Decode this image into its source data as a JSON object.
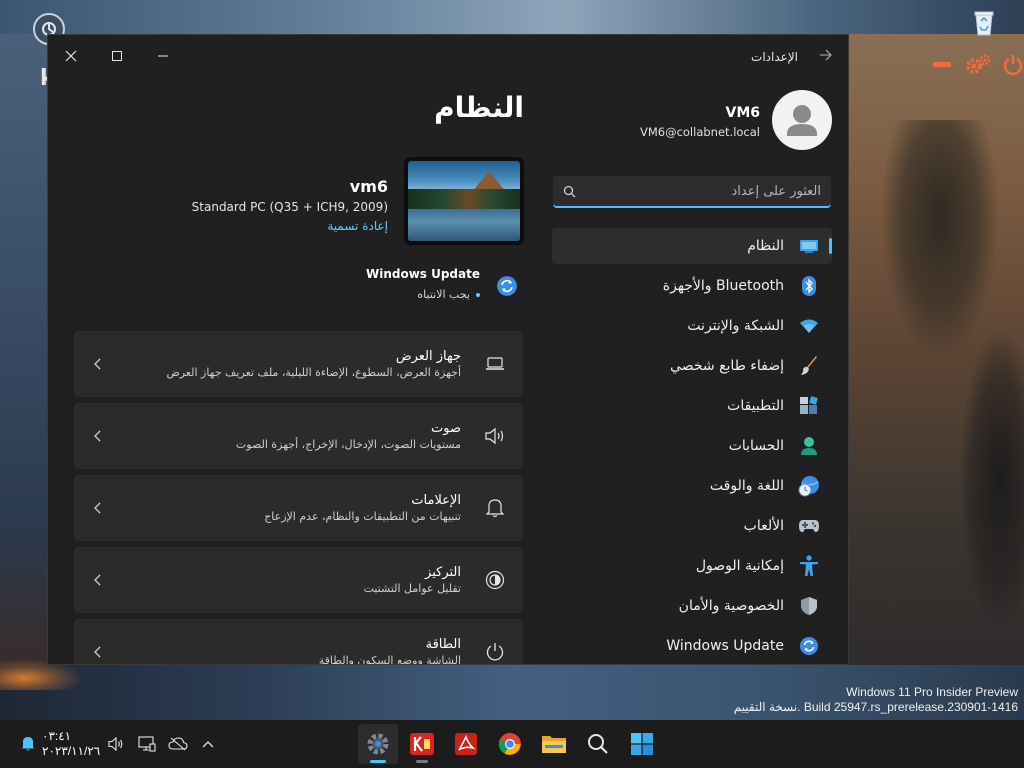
{
  "desktop": {
    "left_letter": "k",
    "watermark": {
      "line1": "Windows 11 Pro Insider Preview",
      "line2": "نسخة التقييم. Build 25947.rs_prerelease.230901-1416"
    }
  },
  "window": {
    "title": "الإعدادات",
    "profile": {
      "name": "VM6",
      "email": "VM6@collabnet.local"
    },
    "search": {
      "placeholder": "العثور على إعداد"
    },
    "nav": [
      {
        "label": "النظام",
        "icon": "display-icon",
        "active": true
      },
      {
        "label": "Bluetooth والأجهزة",
        "icon": "bluetooth-icon"
      },
      {
        "label": "الشبكة والإنترنت",
        "icon": "wifi-icon"
      },
      {
        "label": "إضفاء طابع شخصي",
        "icon": "brush-icon"
      },
      {
        "label": "التطبيقات",
        "icon": "apps-icon"
      },
      {
        "label": "الحسابات",
        "icon": "account-icon"
      },
      {
        "label": "اللغة والوقت",
        "icon": "globe-clock-icon"
      },
      {
        "label": "الألعاب",
        "icon": "gamepad-icon"
      },
      {
        "label": "إمكانية الوصول",
        "icon": "accessibility-icon"
      },
      {
        "label": "الخصوصية والأمان",
        "icon": "shield-icon"
      },
      {
        "label": "Windows Update",
        "icon": "update-icon"
      }
    ],
    "main": {
      "title": "النظام",
      "device": {
        "name": "vm6",
        "model": "Standard PC (Q35 + ICH9, 2009)",
        "rename": "إعادة تسمية"
      },
      "windows_update": {
        "title": "Windows Update",
        "status": "يجب الانتباه"
      },
      "cards": [
        {
          "title": "جهاز العرض",
          "subtitle": "أجهزة العرض، السطوع، الإضاءة الليلية، ملف تعريف جهاز العرض",
          "icon": "laptop-icon"
        },
        {
          "title": "صوت",
          "subtitle": "مستويات الصوت، الإدخال، الإخراج، أجهزة الصوت",
          "icon": "speaker-icon"
        },
        {
          "title": "الإعلامات",
          "subtitle": "تنبيهات من التطبيقات والنظام، عدم الإزعاج",
          "icon": "bell-icon"
        },
        {
          "title": "التركيز",
          "subtitle": "تقليل عوامل التشتيت",
          "icon": "focus-icon"
        },
        {
          "title": "الطاقة",
          "subtitle": "الشاشة ووضع السكون والطاقة",
          "icon": "power-icon"
        }
      ]
    }
  },
  "taskbar": {
    "time": "٠٣:٤١",
    "date": "٢٠٢٣/١١/٢٦",
    "apps": [
      {
        "name": "settings-app",
        "active": true
      },
      {
        "name": "k-app"
      },
      {
        "name": "pdf-app"
      },
      {
        "name": "chrome-app"
      },
      {
        "name": "file-explorer-app"
      },
      {
        "name": "search-app"
      },
      {
        "name": "start-app"
      }
    ]
  },
  "colors": {
    "accent": "#4cc2ff",
    "link": "#60cdff",
    "window_bg": "#202020",
    "card_bg": "#2b2b2b"
  }
}
